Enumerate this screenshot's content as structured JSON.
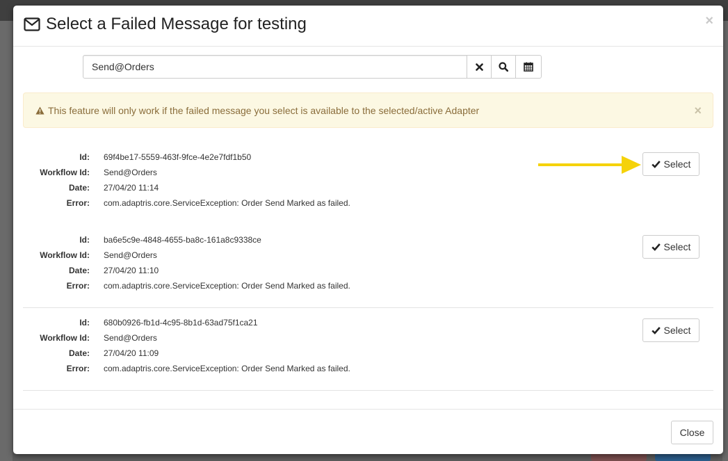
{
  "modal": {
    "title": "Select a Failed Message for testing",
    "close_glyph": "×"
  },
  "search": {
    "value": "Send@Orders",
    "clear_icon": "times-icon",
    "search_icon": "search-icon",
    "calendar_icon": "calendar-icon"
  },
  "alert": {
    "text": "This feature will only work if the failed message you select is available to the selected/active Adapter",
    "close_glyph": "×",
    "icon": "warning-icon"
  },
  "labels": {
    "id": "Id:",
    "workflow_id": "Workflow Id:",
    "date": "Date:",
    "error": "Error:"
  },
  "messages": [
    {
      "id": "69f4be17-5559-463f-9fce-4e2e7fdf1b50",
      "workflow_id": "Send@Orders",
      "date": "27/04/20 11:14",
      "error": "com.adaptris.core.ServiceException: Order Send Marked as failed.",
      "button": "Select"
    },
    {
      "id": "ba6e5c9e-4848-4655-ba8c-161a8c9338ce",
      "workflow_id": "Send@Orders",
      "date": "27/04/20 11:10",
      "error": "com.adaptris.core.ServiceException: Order Send Marked as failed.",
      "button": "Select"
    },
    {
      "id": "680b0926-fb1d-4c95-8b1d-63ad75f1ca21",
      "workflow_id": "Send@Orders",
      "date": "27/04/20 11:09",
      "error": "com.adaptris.core.ServiceException: Order Send Marked as failed.",
      "button": "Select"
    }
  ],
  "footer": {
    "close_label": "Close"
  },
  "colors": {
    "alert_bg": "#fcf8e3",
    "alert_text": "#8a6d3b",
    "annotation_arrow": "#f5d20a"
  }
}
